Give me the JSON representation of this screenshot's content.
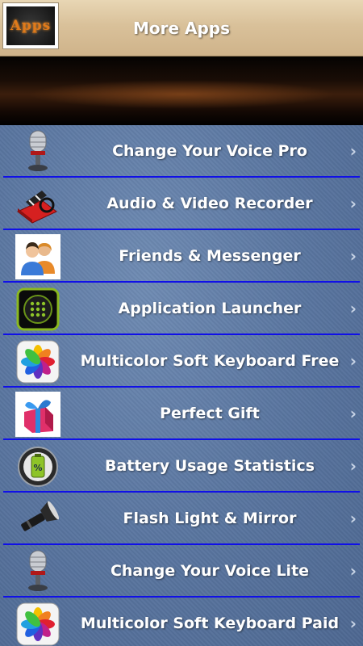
{
  "header": {
    "title": "More Apps",
    "logo_text": "Apps"
  },
  "items": [
    {
      "label": "Change Your Voice Pro",
      "icon": "microphone-icon"
    },
    {
      "label": "Audio & Video Recorder",
      "icon": "film-clapper-icon"
    },
    {
      "label": "Friends & Messenger",
      "icon": "friends-icon"
    },
    {
      "label": "Application Launcher",
      "icon": "app-grid-icon"
    },
    {
      "label": "Multicolor Soft Keyboard Free",
      "icon": "flower-icon"
    },
    {
      "label": "Perfect Gift",
      "icon": "gift-icon"
    },
    {
      "label": "Battery Usage Statistics",
      "icon": "battery-icon"
    },
    {
      "label": "Flash Light & Mirror",
      "icon": "flashlight-icon"
    },
    {
      "label": "Change Your Voice Lite",
      "icon": "microphone-icon"
    },
    {
      "label": "Multicolor Soft Keyboard Paid",
      "icon": "flower-icon"
    }
  ],
  "chevron": "›",
  "colors": {
    "divider": "#1010e8",
    "list_background": "#5a76a0",
    "header_background": "#d9c19a"
  }
}
